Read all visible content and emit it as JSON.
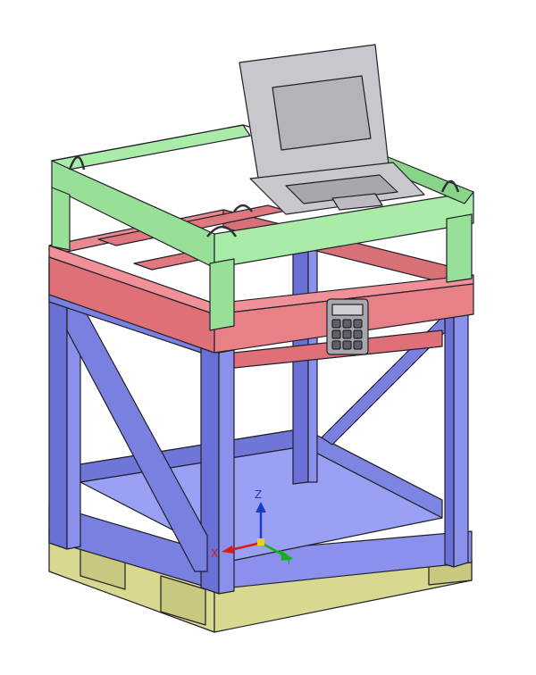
{
  "scene": {
    "description_visible_text": "",
    "axis_triad": {
      "z_label": "Z",
      "x_label": "X",
      "y_label": "Y",
      "z_color": "#1a3cc8",
      "x_color": "#e01818",
      "y_color": "#18b018"
    },
    "keypad_keys": [
      "",
      "",
      "",
      "",
      "",
      "",
      "",
      "",
      ""
    ],
    "colors": {
      "background": "#ffffff",
      "frame_blue": "#7a80e0",
      "frame_blue_dark": "#5a60c8",
      "frame_red": "#e07078",
      "frame_red_dark": "#c85860",
      "frame_green": "#98e098",
      "frame_green_dark": "#78c878",
      "pallet": "#d8d890",
      "laptop": "#c8c8c8",
      "laptop_screen": "#b8b8b8",
      "keypad": "#a8a8a8",
      "outline": "#202028"
    }
  }
}
